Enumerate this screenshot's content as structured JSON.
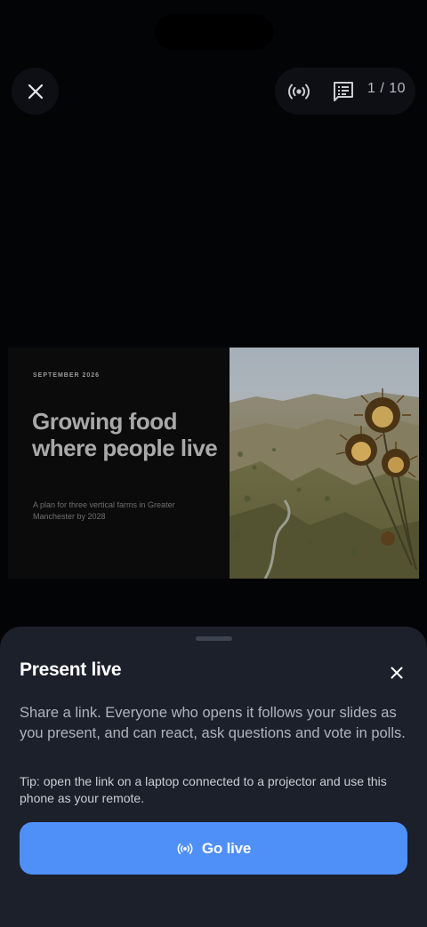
{
  "top_bar": {
    "close_icon": "close-icon",
    "live_icon": "broadcast-icon",
    "notes_icon": "speaker-notes-icon",
    "slide_counter": "1 / 10"
  },
  "slide": {
    "date": "SEPTEMBER 2026",
    "title": "Growing food where people live",
    "subtitle": "A plan for three vertical farms in Greater Manchester by 2028",
    "photo": "landscape-with-thistles"
  },
  "sheet": {
    "title": "Present live",
    "close_icon": "close-icon",
    "description": "Share a link. Everyone who opens it follows your slides as you present, and can react, ask questions and vote in polls.",
    "tip": "Tip: open the link on a laptop connected to a projector and use this phone as your remote.",
    "go_live_label": "Go live",
    "go_live_icon": "broadcast-icon"
  },
  "colors": {
    "background": "#030406",
    "sheet": "#1b202a",
    "accent": "#4f8ff8",
    "text_primary": "#ffffff",
    "text_secondary": "#aeb3bc"
  }
}
